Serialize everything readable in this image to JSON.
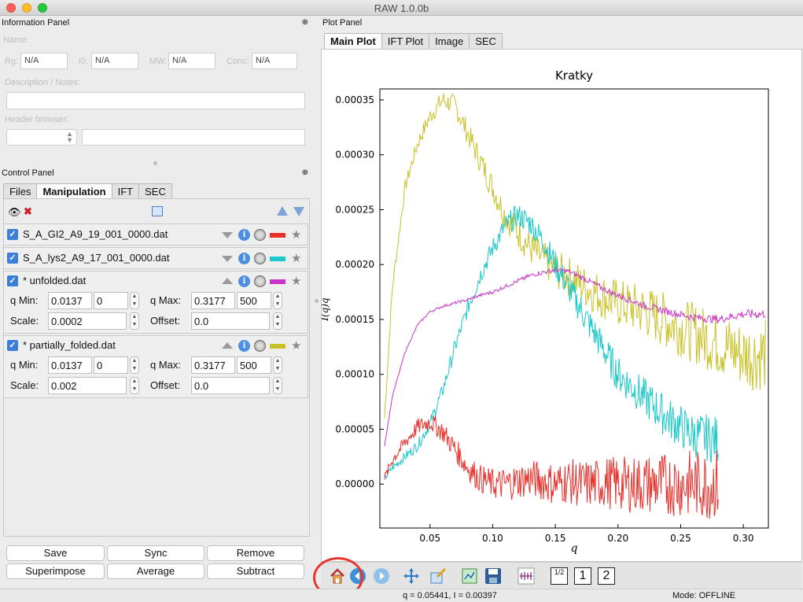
{
  "window": {
    "title": "RAW 1.0.0b"
  },
  "info_panel": {
    "title": "Information Panel",
    "pin_icon": "pin-icon",
    "name_label": "Name:",
    "fields": [
      {
        "label": "Rg:",
        "value": "N/A"
      },
      {
        "label": "I0:",
        "value": "N/A"
      },
      {
        "label": "MW:",
        "value": "N/A"
      },
      {
        "label": "Conc:",
        "value": "N/A"
      }
    ],
    "description_label": "Description / Notes:",
    "header_browser_label": "Header browser:"
  },
  "control_panel": {
    "title": "Control Panel",
    "tabs": [
      "Files",
      "Manipulation",
      "IFT",
      "SEC"
    ],
    "active_tab": "Manipulation",
    "items": [
      {
        "name": "S_A_GI2_A9_19_001_0000.dat",
        "color": "#e8302a",
        "expanded": false
      },
      {
        "name": "S_A_lys2_A9_17_001_0000.dat",
        "color": "#1cc8c8",
        "expanded": false
      },
      {
        "name": "* unfolded.dat",
        "color": "#cc33cc",
        "expanded": true,
        "q_min_label": "q Min:",
        "q_min": "0.0137",
        "q_min_idx": "0",
        "q_max_label": "q Max:",
        "q_max": "0.3177",
        "q_max_idx": "500",
        "scale_label": "Scale:",
        "scale": "0.0002",
        "offset_label": "Offset:",
        "offset": "0.0"
      },
      {
        "name": "* partially_folded.dat",
        "color": "#c8c228",
        "expanded": true,
        "q_min_label": "q Min:",
        "q_min": "0.0137",
        "q_min_idx": "0",
        "q_max_label": "q Max:",
        "q_max": "0.3177",
        "q_max_idx": "500",
        "scale_label": "Scale:",
        "scale": "0.002",
        "offset_label": "Offset:",
        "offset": "0.0"
      }
    ],
    "buttons": [
      "Save",
      "Sync",
      "Remove",
      "Superimpose",
      "Average",
      "Subtract"
    ]
  },
  "plot_panel": {
    "title": "Plot Panel",
    "tabs": [
      "Main Plot",
      "IFT Plot",
      "Image",
      "SEC"
    ],
    "active_tab": "Main Plot",
    "toolbar_icons": [
      "home-icon",
      "back-arrow-icon",
      "forward-arrow-icon",
      "pan-icon",
      "zoom-icon",
      "subplots-icon",
      "save-icon",
      "errorbar-icon"
    ],
    "page_buttons": [
      "1/2",
      "1",
      "2"
    ]
  },
  "status": {
    "coords": "q = 0.05441, I = 0.00397",
    "mode": "Mode: OFFLINE"
  },
  "chart_data": {
    "type": "line",
    "title": "Kratky",
    "xlabel": "q",
    "ylabel": "I(q)q",
    "xlim": [
      0.01,
      0.32
    ],
    "ylim": [
      -4e-05,
      0.00036
    ],
    "xticks": [
      "0.05",
      "0.10",
      "0.15",
      "0.20",
      "0.25",
      "0.30"
    ],
    "yticks": [
      "0.00000",
      "0.00005",
      "0.00010",
      "0.00015",
      "0.00020",
      "0.00025",
      "0.00030",
      "0.00035"
    ],
    "series": [
      {
        "color": "#c8c228",
        "noise": 1.2e-05,
        "x": [
          0.0137,
          0.02,
          0.03,
          0.04,
          0.05,
          0.06,
          0.07,
          0.08,
          0.09,
          0.1,
          0.11,
          0.12,
          0.13,
          0.14,
          0.15,
          0.16,
          0.17,
          0.18,
          0.19,
          0.2,
          0.22,
          0.24,
          0.26,
          0.28,
          0.3,
          0.3177
        ],
        "y": [
          6e-05,
          0.00018,
          0.00027,
          0.00031,
          0.000335,
          0.00035,
          0.000345,
          0.00032,
          0.000295,
          0.00027,
          0.000245,
          0.00023,
          0.000215,
          0.000205,
          0.000195,
          0.00019,
          0.000182,
          0.000176,
          0.00017,
          0.000165,
          0.000158,
          0.000148,
          0.000138,
          0.000128,
          0.000118,
          0.000118
        ]
      },
      {
        "color": "#1cc8c8",
        "noise": 8e-06,
        "x": [
          0.0137,
          0.02,
          0.03,
          0.04,
          0.05,
          0.06,
          0.07,
          0.08,
          0.09,
          0.1,
          0.11,
          0.12,
          0.13,
          0.14,
          0.15,
          0.16,
          0.17,
          0.18,
          0.19,
          0.2,
          0.22,
          0.24,
          0.26,
          0.28
        ],
        "y": [
          5e-06,
          1.5e-05,
          2.5e-05,
          3.5e-05,
          5.5e-05,
          8.5e-05,
          0.000125,
          0.00016,
          0.00019,
          0.000215,
          0.000235,
          0.000245,
          0.000238,
          0.000222,
          0.0002,
          0.00018,
          0.00016,
          0.00014,
          0.00012,
          0.0001,
          8e-05,
          6e-05,
          4.5e-05,
          4e-05
        ]
      },
      {
        "color": "#cc33cc",
        "noise": 1.5e-06,
        "x": [
          0.0137,
          0.02,
          0.03,
          0.04,
          0.05,
          0.06,
          0.07,
          0.08,
          0.09,
          0.1,
          0.11,
          0.12,
          0.13,
          0.14,
          0.15,
          0.16,
          0.17,
          0.18,
          0.19,
          0.2,
          0.22,
          0.24,
          0.26,
          0.28,
          0.3,
          0.3177
        ],
        "y": [
          3.5e-05,
          8e-05,
          0.00012,
          0.000145,
          0.000157,
          0.000162,
          0.000165,
          0.000168,
          0.000172,
          0.000175,
          0.00018,
          0.000185,
          0.00019,
          0.000193,
          0.000195,
          0.000194,
          0.000189,
          0.000183,
          0.000177,
          0.000172,
          0.000163,
          0.000157,
          0.000152,
          0.00015,
          0.000155,
          0.000155
        ]
      },
      {
        "color": "#e8302a",
        "noise": 1.2e-05,
        "x": [
          0.0137,
          0.02,
          0.03,
          0.04,
          0.05,
          0.06,
          0.07,
          0.08,
          0.09,
          0.1,
          0.11,
          0.12,
          0.13,
          0.14,
          0.15,
          0.16,
          0.17,
          0.18,
          0.19,
          0.2,
          0.22,
          0.24,
          0.26,
          0.28
        ],
        "y": [
          5e-06,
          2.2e-05,
          3.8e-05,
          5.2e-05,
          5.7e-05,
          4.8e-05,
          3.2e-05,
          1.5e-05,
          5e-06,
          0.0,
          0.0,
          3e-06,
          5e-06,
          3e-06,
          0.0,
          3e-06,
          0.0,
          0.0,
          2e-06,
          0.0,
          0.0,
          0.0,
          0.0,
          0.0
        ]
      }
    ]
  }
}
